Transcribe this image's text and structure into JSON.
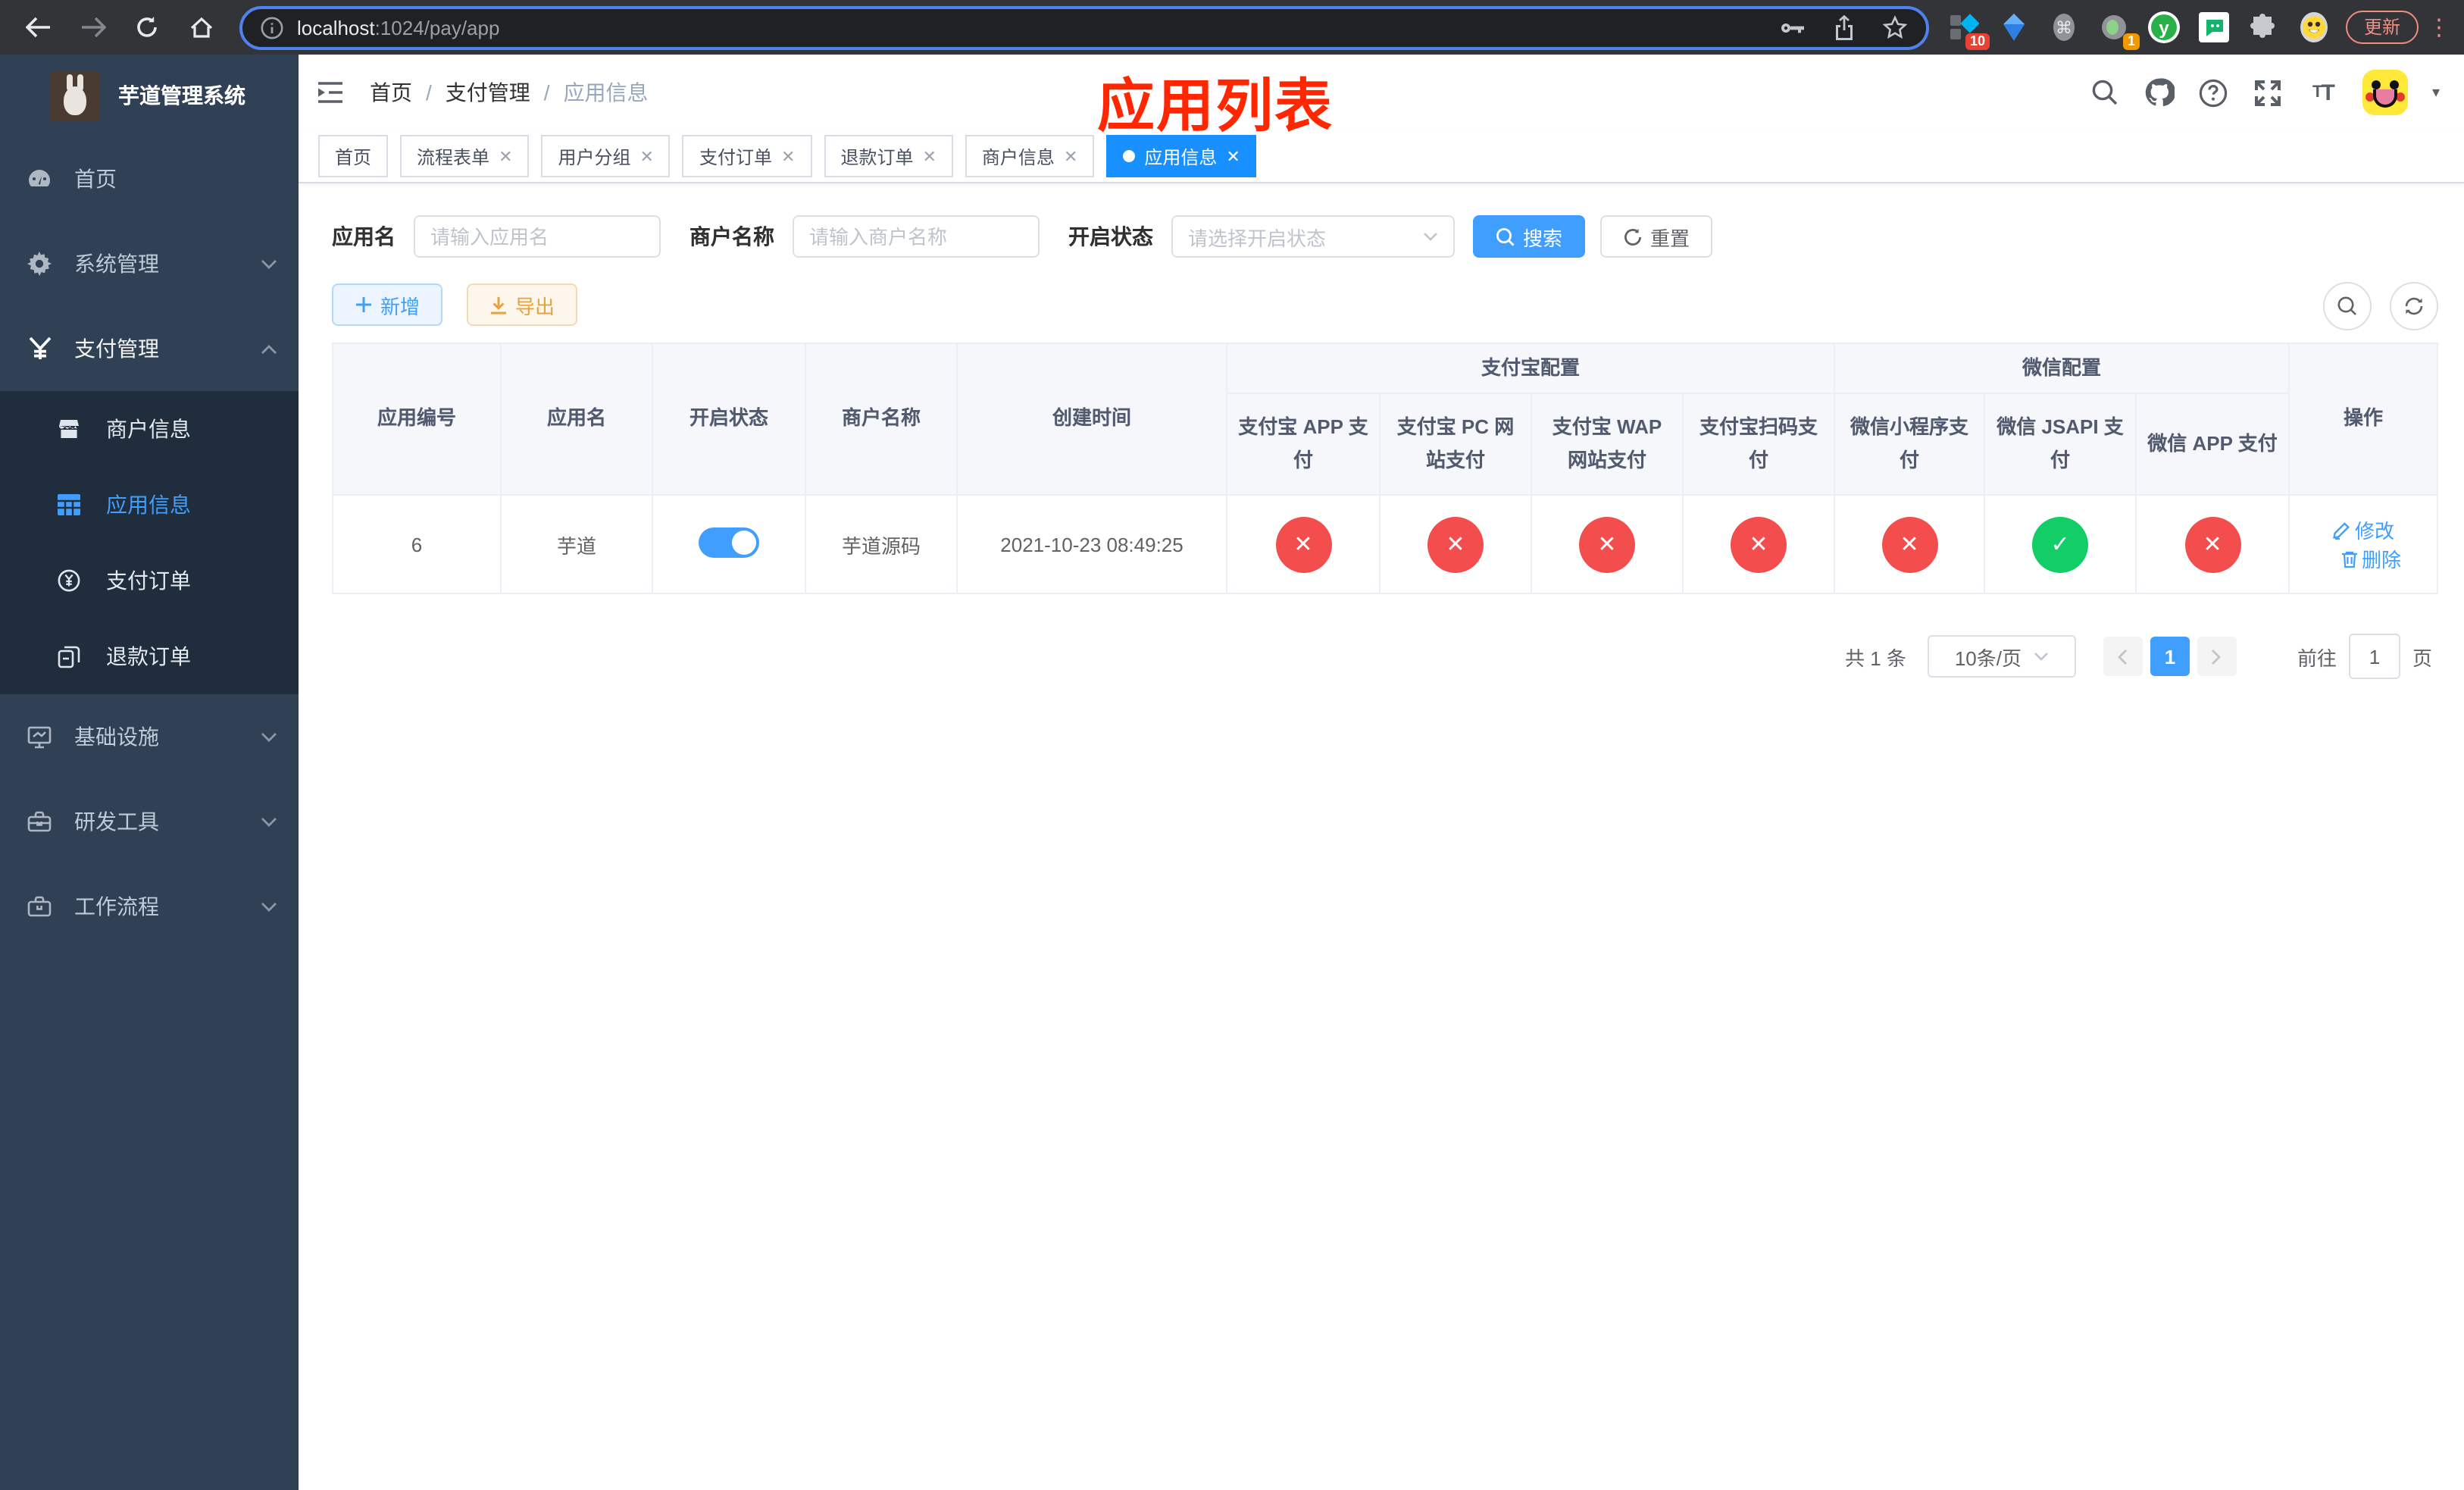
{
  "browser": {
    "url_host": "localhost",
    "url_rest": ":1024/pay/app",
    "update_label": "更新",
    "ext_badge_10": "10",
    "ext_badge_1": "1"
  },
  "sidebar": {
    "title": "芋道管理系统",
    "items": [
      {
        "label": "首页"
      },
      {
        "label": "系统管理"
      },
      {
        "label": "支付管理"
      },
      {
        "label": "基础设施"
      },
      {
        "label": "研发工具"
      },
      {
        "label": "工作流程"
      }
    ],
    "submenu": [
      {
        "label": "商户信息"
      },
      {
        "label": "应用信息"
      },
      {
        "label": "支付订单"
      },
      {
        "label": "退款订单"
      }
    ]
  },
  "navbar": {
    "breadcrumb": [
      "首页",
      "支付管理",
      "应用信息"
    ],
    "annotation": "应用列表"
  },
  "tabs": [
    {
      "label": "首页"
    },
    {
      "label": "流程表单"
    },
    {
      "label": "用户分组"
    },
    {
      "label": "支付订单"
    },
    {
      "label": "退款订单"
    },
    {
      "label": "商户信息"
    },
    {
      "label": "应用信息"
    }
  ],
  "filters": {
    "app_name_label": "应用名",
    "app_name_placeholder": "请输入应用名",
    "merchant_label": "商户名称",
    "merchant_placeholder": "请输入商户名称",
    "status_label": "开启状态",
    "status_placeholder": "请选择开启状态",
    "search_label": "搜索",
    "reset_label": "重置"
  },
  "toolbar": {
    "add_label": "新增",
    "export_label": "导出"
  },
  "table": {
    "group_alipay": "支付宝配置",
    "group_wechat": "微信配置",
    "columns": [
      "应用编号",
      "应用名",
      "开启状态",
      "商户名称",
      "创建时间",
      "支付宝 APP 支付",
      "支付宝 PC 网站支付",
      "支付宝 WAP 网站支付",
      "支付宝扫码支付",
      "微信小程序支付",
      "微信 JSAPI 支付",
      "微信 APP 支付",
      "操作"
    ],
    "row": {
      "id": "6",
      "name": "芋道",
      "enabled": true,
      "merchant": "芋道源码",
      "created_at": "2021-10-23 08:49:25",
      "statuses": [
        "fail",
        "fail",
        "fail",
        "fail",
        "fail",
        "success",
        "fail"
      ],
      "edit_label": "修改",
      "delete_label": "删除"
    }
  },
  "pagination": {
    "total": "共 1 条",
    "page_size": "10条/页",
    "page": "1",
    "goto_prefix": "前往",
    "goto_value": "1",
    "goto_suffix": "页"
  },
  "colors": {
    "accent": "#409eff",
    "active_tab": "#1890ff",
    "success": "#13ce66",
    "danger": "#f34d4d",
    "warning": "#e6a23c",
    "annotation": "#ff2600"
  }
}
